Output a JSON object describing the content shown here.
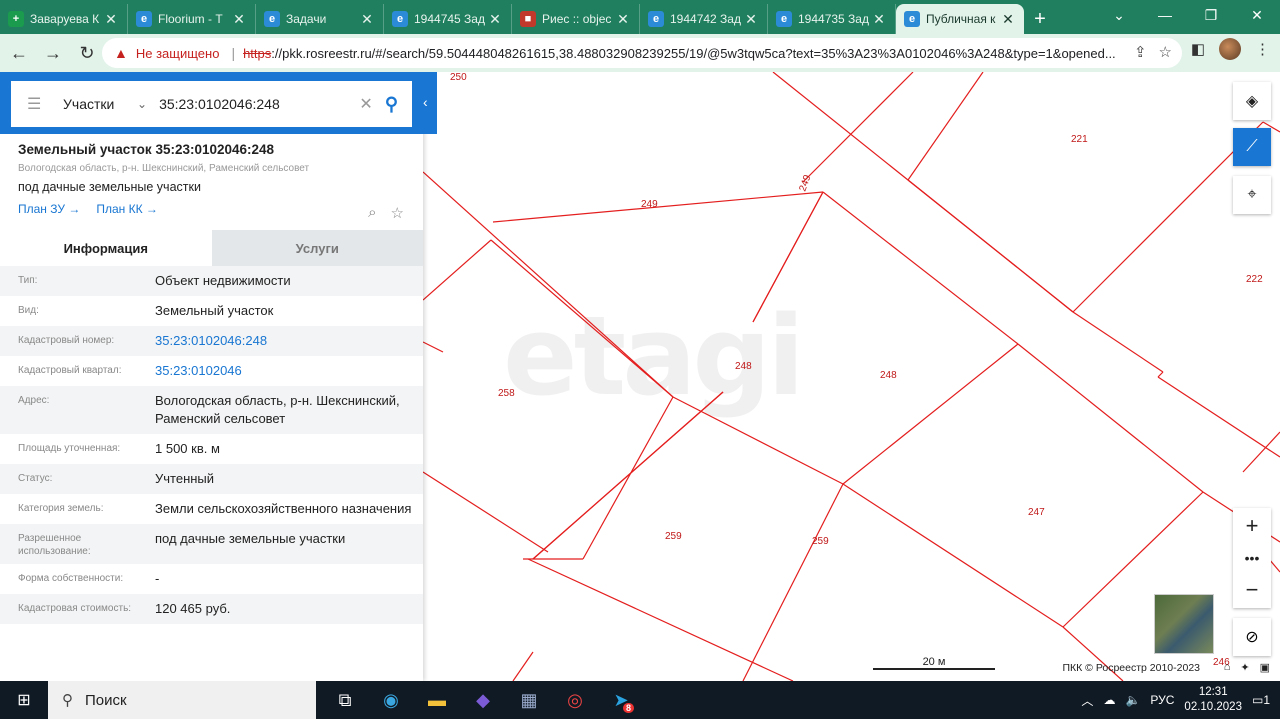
{
  "browser": {
    "tabs": [
      {
        "title": "Заваруева К",
        "favicon": "green-plus-icon",
        "color": "#1a9b4e"
      },
      {
        "title": "Floorium - Т",
        "favicon": "etagi-icon",
        "color": "#2b8bd6"
      },
      {
        "title": "Задачи",
        "favicon": "etagi-icon",
        "color": "#2b8bd6"
      },
      {
        "title": "1944745 Зад",
        "favicon": "etagi-icon",
        "color": "#2b8bd6"
      },
      {
        "title": "Риес :: objec",
        "favicon": "riec-icon",
        "color": "#c0392b"
      },
      {
        "title": "1944742 Зад",
        "favicon": "etagi-icon",
        "color": "#2b8bd6"
      },
      {
        "title": "1944735 Зад",
        "favicon": "etagi-icon",
        "color": "#2b8bd6"
      },
      {
        "title": "Публичная к",
        "favicon": "rosreestr-icon",
        "color": "#2b8bd6",
        "active": true
      }
    ],
    "not_secure": "Не защищено",
    "url_proto": "https",
    "url_rest": "://pkk.rosreestr.ru/#/search/59.504448048261615,38.488032908239255/19/@5w3tqw5ca?text=35%3A23%3A0102046%3A248&type=1&opened..."
  },
  "search": {
    "type": "Участки",
    "value": "35:23:0102046:248"
  },
  "object": {
    "title": "Земельный участок 35:23:0102046:248",
    "address": "Вологодская область, р-н. Шекснинский, Раменский сельсовет",
    "use": "под дачные земельные участки",
    "link1": "План ЗУ →",
    "link2": "План КК →"
  },
  "tabs": {
    "info": "Информация",
    "services": "Услуги"
  },
  "rows": [
    {
      "k": "Тип:",
      "v": "Объект недвижимости"
    },
    {
      "k": "Вид:",
      "v": "Земельный участок"
    },
    {
      "k": "Кадастровый номер:",
      "v": "35:23:0102046:248",
      "link": true
    },
    {
      "k": "Кадастровый квартал:",
      "v": "35:23:0102046",
      "link": true
    },
    {
      "k": "Адрес:",
      "v": "Вологодская область, р-н. Шекснинский, Раменский сельсовет"
    },
    {
      "k": "Площадь уточненная:",
      "v": "1 500 кв. м"
    },
    {
      "k": "Статус:",
      "v": "Учтенный"
    },
    {
      "k": "Категория земель:",
      "v": "Земли сельскохозяйственного назначения"
    },
    {
      "k": "Разрешенное использование:",
      "v": "под дачные земельные участки"
    },
    {
      "k": "Форма собственности:",
      "v": "-"
    },
    {
      "k": "Кадастровая стоимость:",
      "v": "120 465 руб."
    }
  ],
  "map": {
    "watermark": "etagi",
    "labels": [
      "250",
      "249",
      "249",
      "221",
      "222",
      "258",
      "248",
      "248",
      "259",
      "259",
      "247",
      "246"
    ],
    "scale": "20 м",
    "copyright": "ПКК © Росреестр 2010-2023"
  },
  "taskbar": {
    "search": "Поиск",
    "lang": "РУС",
    "time": "12:31",
    "date": "02.10.2023",
    "telegram_badge": "8",
    "notif": "1"
  }
}
